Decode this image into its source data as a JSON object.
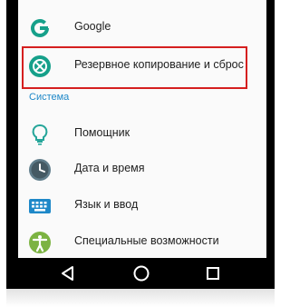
{
  "settings": {
    "items": [
      {
        "label": "Google",
        "icon": "google-g-icon"
      },
      {
        "label": "Резервное копирование и сброс",
        "icon": "backup-reset-icon"
      }
    ],
    "section_header": "Система",
    "system_items": [
      {
        "label": "Помощник",
        "icon": "lightbulb-icon"
      },
      {
        "label": "Дата и время",
        "icon": "clock-icon"
      },
      {
        "label": "Язык и ввод",
        "icon": "keyboard-icon"
      },
      {
        "label": "Специальные возможности",
        "icon": "accessibility-icon"
      }
    ]
  },
  "navbar": {
    "buttons": [
      "back-icon",
      "home-icon",
      "recents-icon"
    ]
  },
  "colors": {
    "accent": "#1e88c8",
    "highlight_border": "#d51f1f",
    "google_teal": "#16a08a",
    "backup_teal": "#16a08a"
  }
}
